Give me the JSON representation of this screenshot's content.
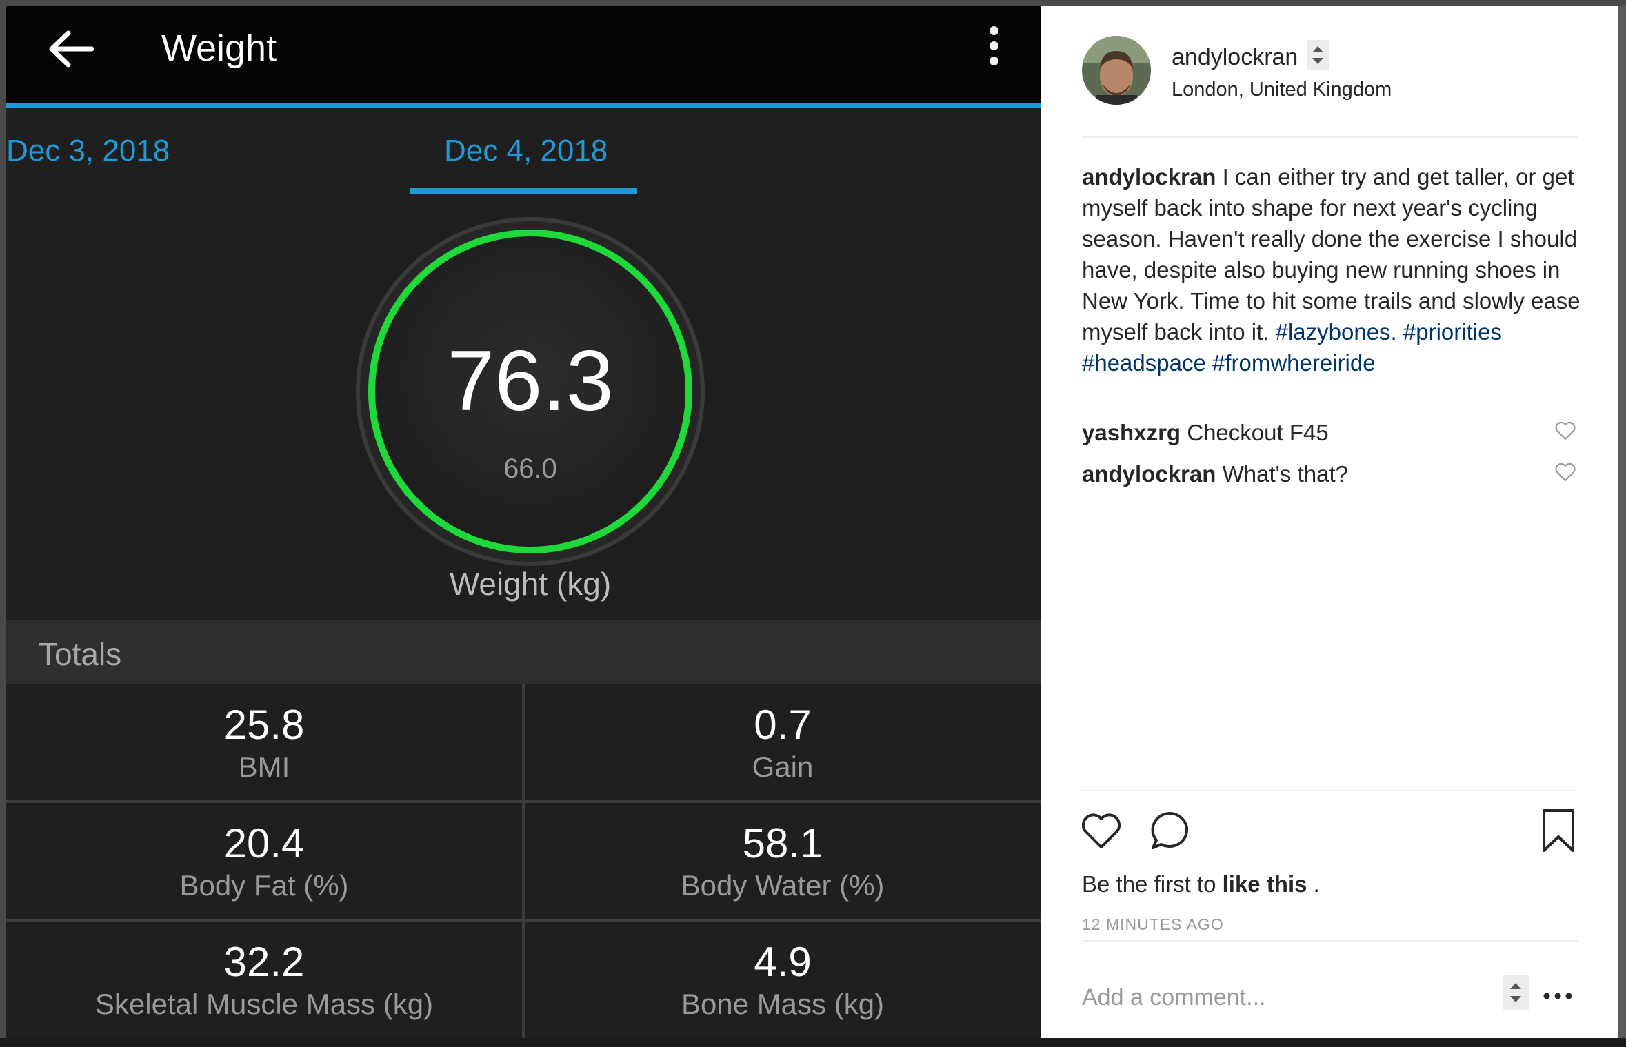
{
  "app": {
    "title": "Weight",
    "tabs": [
      {
        "label": "Dec 3, 2018"
      },
      {
        "label": "Dec 4, 2018"
      }
    ],
    "weight": {
      "value": "76.3",
      "goal": "66.0",
      "label": "Weight (kg)"
    },
    "totals_label": "Totals",
    "metrics": [
      {
        "value": "25.8",
        "label": "BMI"
      },
      {
        "value": "0.7",
        "label": "Gain"
      },
      {
        "value": "20.4",
        "label": "Body Fat (%)"
      },
      {
        "value": "58.1",
        "label": "Body Water (%)"
      },
      {
        "value": "32.2",
        "label": "Skeletal Muscle Mass (kg)"
      },
      {
        "value": "4.9",
        "label": "Bone Mass (kg)"
      }
    ],
    "colors": {
      "accent": "#1e9bd7",
      "ring": "#1fd83a",
      "background": "#1f1f1f"
    }
  },
  "post": {
    "username": "andylockran",
    "location": "London, United Kingdom",
    "caption": {
      "author": "andylockran",
      "text": "I can either try and get taller, or get myself back into shape for next year's cycling season. Haven't really done the exercise I should have, despite also buying new running shoes in New York. Time to hit some trails and slowly ease myself back into it.",
      "hashtags": [
        "#lazybones.",
        "#priorities",
        "#headspace",
        "#fromwhereiride"
      ]
    },
    "comments": [
      {
        "author": "yashxzrg",
        "text": "Checkout F45"
      },
      {
        "author": "andylockran",
        "text": "What's that?"
      }
    ],
    "likes": {
      "prefix": "Be the first to",
      "action": "like this",
      "suffix": "."
    },
    "time_ago": "12 MINUTES AGO",
    "add_comment_placeholder": "Add a comment..."
  }
}
